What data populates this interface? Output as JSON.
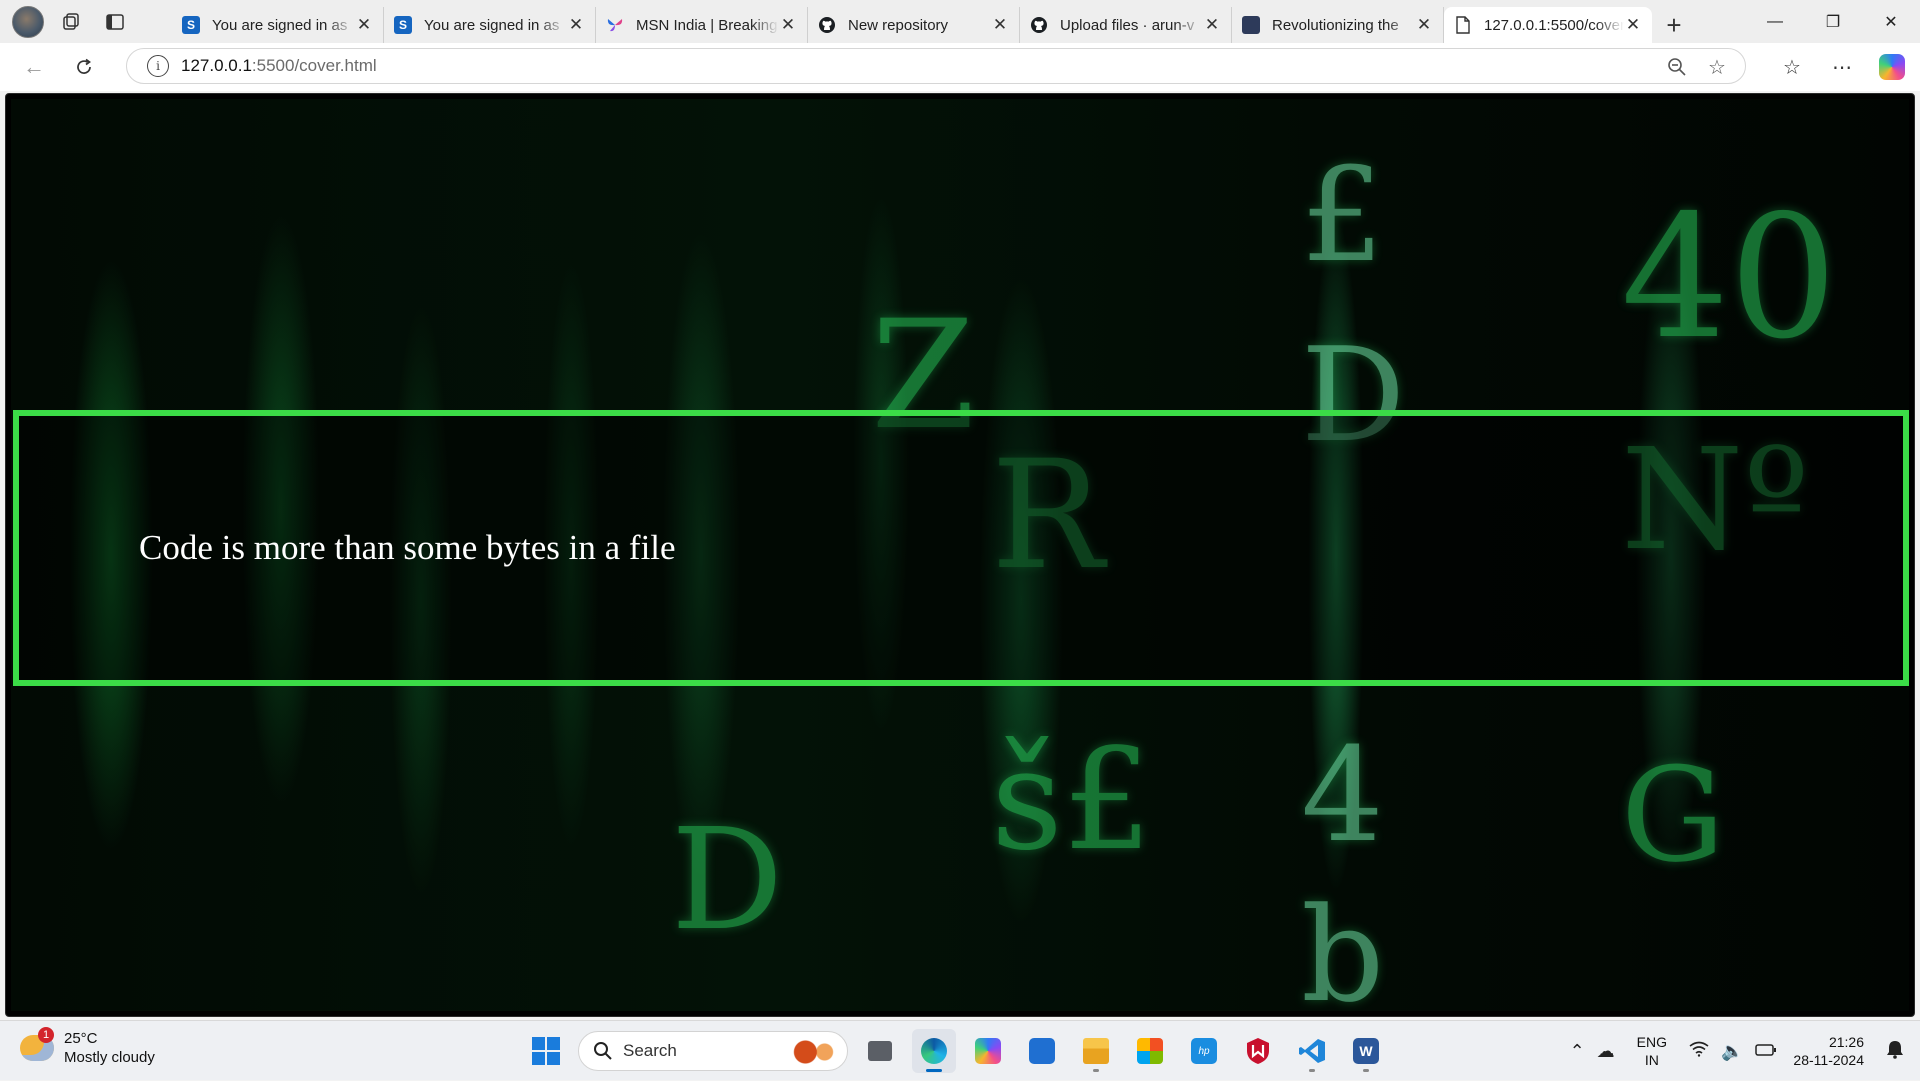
{
  "browser": {
    "tabs": [
      {
        "title": "You are signed in as",
        "favicon": "s-icon",
        "active": false
      },
      {
        "title": "You are signed in as",
        "favicon": "s-icon",
        "active": false
      },
      {
        "title": "MSN India | Breaking",
        "favicon": "msn-butterfly-icon",
        "active": false
      },
      {
        "title": "New repository",
        "favicon": "github-icon",
        "active": false
      },
      {
        "title": "Upload files · arun-v",
        "favicon": "github-icon",
        "active": false
      },
      {
        "title": "Revolutionizing the",
        "favicon": "site-icon",
        "active": false
      },
      {
        "title": "127.0.0.1:5500/cover",
        "favicon": "page-icon",
        "active": true
      }
    ],
    "close_glyph": "✕",
    "new_tab_glyph": "+",
    "address": {
      "host": "127.0.0.1",
      "path": ":5500/cover.html"
    },
    "window_controls": {
      "minimize": "—",
      "restore": "❐",
      "close": "✕"
    }
  },
  "page": {
    "banner_text": "Code is more than some bytes in a file",
    "accent_color": "#3bdc47"
  },
  "taskbar": {
    "weather": {
      "temp": "25°C",
      "condition": "Mostly cloudy",
      "badge": "1"
    },
    "search_label": "Search",
    "language": {
      "line1": "ENG",
      "line2": "IN"
    },
    "clock": {
      "time": "21:26",
      "date": "28-11-2024"
    }
  }
}
